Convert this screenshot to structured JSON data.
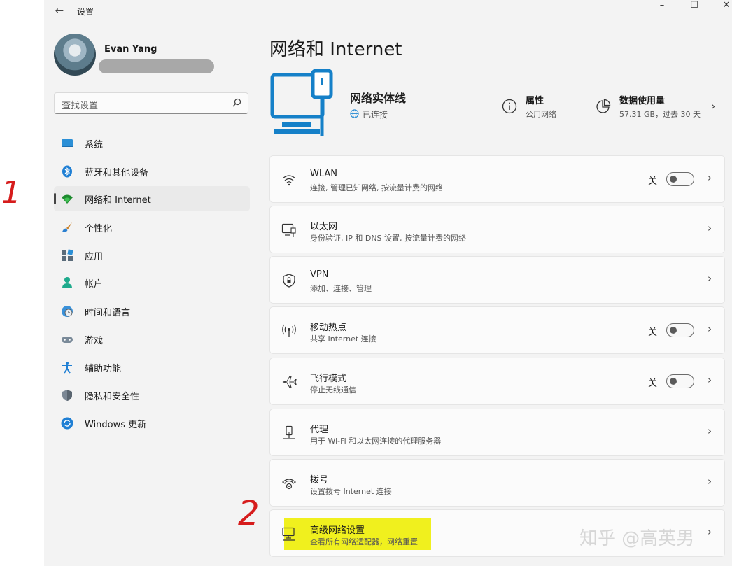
{
  "titlebar": {
    "title": "设置",
    "back_glyph": "←",
    "minimize": "–",
    "maximize": "☐",
    "close": "✕"
  },
  "user": {
    "name": "Evan Yang"
  },
  "search": {
    "placeholder": "查找设置"
  },
  "sidebar": {
    "items": [
      {
        "label": "系统",
        "icon": "system-icon"
      },
      {
        "label": "蓝牙和其他设备",
        "icon": "bluetooth-icon"
      },
      {
        "label": "网络和 Internet",
        "icon": "wifi-icon",
        "active": true
      },
      {
        "label": "个性化",
        "icon": "brush-icon"
      },
      {
        "label": "应用",
        "icon": "apps-icon"
      },
      {
        "label": "帐户",
        "icon": "account-icon"
      },
      {
        "label": "时间和语言",
        "icon": "globe-clock-icon"
      },
      {
        "label": "游戏",
        "icon": "gamepad-icon"
      },
      {
        "label": "辅助功能",
        "icon": "accessibility-icon"
      },
      {
        "label": "隐私和安全性",
        "icon": "shield-icon"
      },
      {
        "label": "Windows 更新",
        "icon": "update-icon"
      }
    ]
  },
  "main": {
    "title": "网络和 Internet",
    "hero": {
      "name": "网络实体线",
      "status": "已连接"
    },
    "properties": {
      "title": "属性",
      "sub": "公用网络"
    },
    "data_usage": {
      "title": "数据使用量",
      "sub": "57.31 GB，过去 30 天"
    },
    "cards": [
      {
        "title": "WLAN",
        "desc": "连接, 管理已知网络, 按流量计费的网络",
        "icon": "wifi-icon",
        "toggle": "关"
      },
      {
        "title": "以太网",
        "desc": "身份验证, IP 和 DNS 设置, 按流量计费的网络",
        "icon": "ethernet-icon"
      },
      {
        "title": "VPN",
        "desc": "添加、连接、管理",
        "icon": "vpn-shield-icon"
      },
      {
        "title": "移动热点",
        "desc": "共享 Internet 连接",
        "icon": "hotspot-icon",
        "toggle": "关"
      },
      {
        "title": "飞行模式",
        "desc": "停止无线通信",
        "icon": "airplane-icon",
        "toggle": "关"
      },
      {
        "title": "代理",
        "desc": "用于 Wi-Fi 和以太网连接的代理服务器",
        "icon": "proxy-icon"
      },
      {
        "title": "拨号",
        "desc": "设置拨号 Internet 连接",
        "icon": "dialup-icon"
      },
      {
        "title": "高级网络设置",
        "desc": "查看所有网络适配器，网络重置",
        "icon": "advanced-network-icon"
      }
    ]
  },
  "watermark": "知乎 @高英男",
  "annotations": {
    "one": "1",
    "two": "2"
  },
  "colors": {
    "accent": "#0067c0",
    "highlight": "#f0f01e",
    "annotation": "#d61c1c"
  }
}
